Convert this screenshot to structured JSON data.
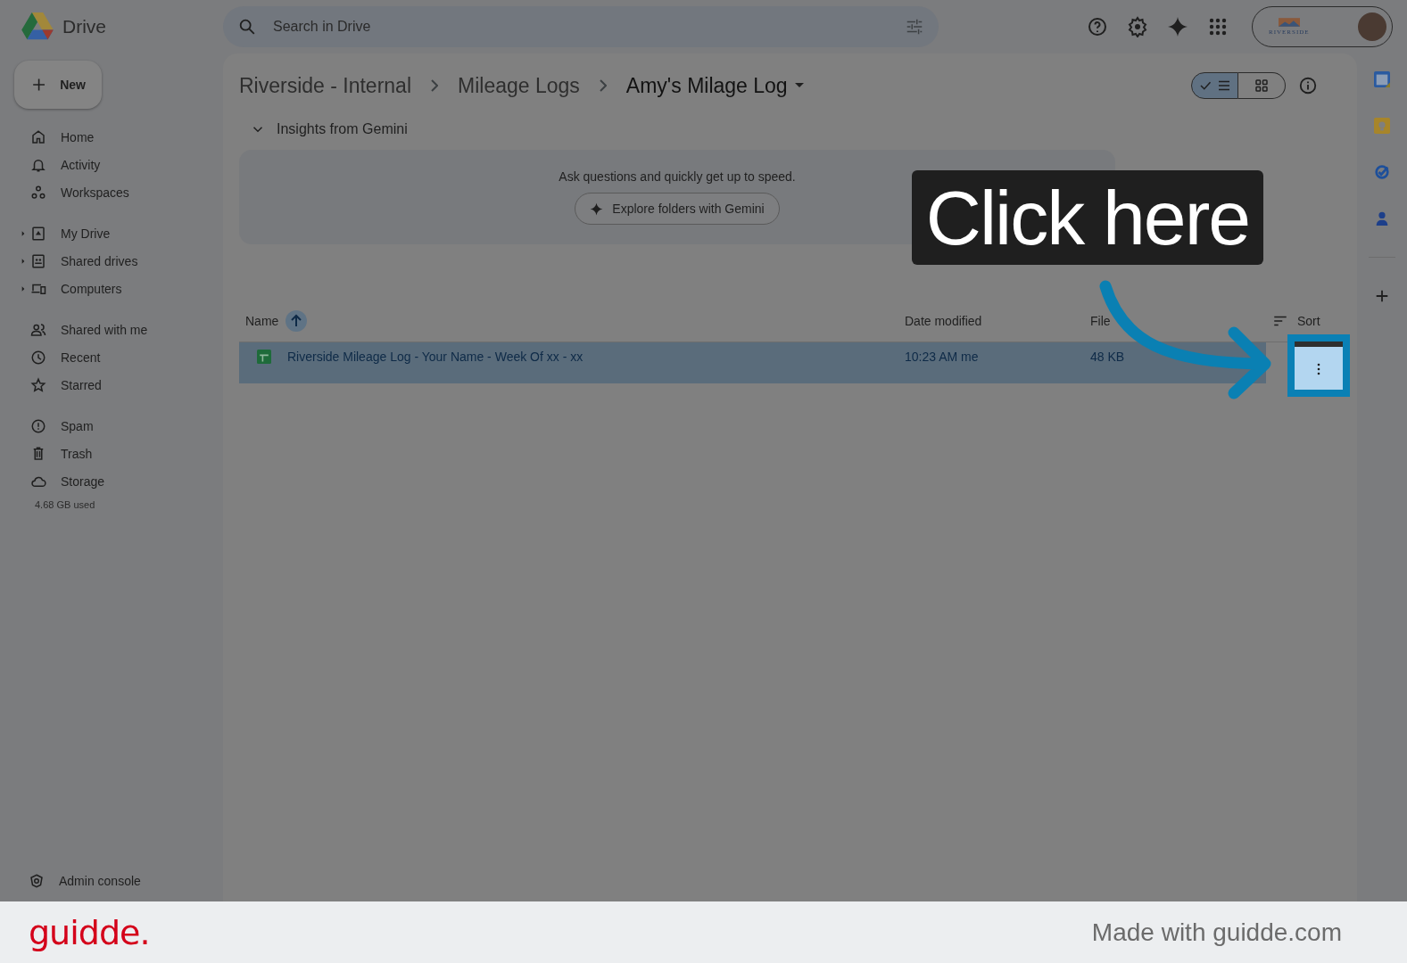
{
  "app": {
    "name": "Drive"
  },
  "search": {
    "placeholder": "Search in Drive"
  },
  "account": {
    "org": "RIVERSIDE"
  },
  "new_button": "New",
  "sidebar": {
    "groups": [
      [
        {
          "kind": "home",
          "label": "Home",
          "expandable": false
        },
        {
          "kind": "activity",
          "label": "Activity",
          "expandable": false
        },
        {
          "kind": "workspaces",
          "label": "Workspaces",
          "expandable": false
        }
      ],
      [
        {
          "kind": "mydrive",
          "label": "My Drive",
          "expandable": true
        },
        {
          "kind": "shareddrives",
          "label": "Shared drives",
          "expandable": true
        },
        {
          "kind": "computers",
          "label": "Computers",
          "expandable": true
        }
      ],
      [
        {
          "kind": "shared",
          "label": "Shared with me",
          "expandable": false
        },
        {
          "kind": "recent",
          "label": "Recent",
          "expandable": false
        },
        {
          "kind": "starred",
          "label": "Starred",
          "expandable": false
        }
      ],
      [
        {
          "kind": "spam",
          "label": "Spam",
          "expandable": false
        },
        {
          "kind": "trash",
          "label": "Trash",
          "expandable": false
        },
        {
          "kind": "storage",
          "label": "Storage",
          "expandable": false
        }
      ]
    ],
    "storage_used": "4.68 GB used",
    "admin": "Admin console"
  },
  "breadcrumbs": [
    {
      "label": "Riverside - Internal",
      "current": false
    },
    {
      "label": "Mileage Logs",
      "current": false
    },
    {
      "label": "Amy's Milage Log",
      "current": true
    }
  ],
  "view_toggle": [
    {
      "kind": "list",
      "selected": true
    },
    {
      "kind": "grid",
      "selected": false
    }
  ],
  "insights": {
    "title": "Insights from Gemini",
    "expanded": true,
    "text": "Ask questions and quickly get up to speed.",
    "button": "Explore folders with Gemini"
  },
  "table": {
    "columns": [
      "Name",
      "Date modified",
      "File"
    ],
    "sort_label": "Sort",
    "rows": [
      {
        "name": "Riverside Mileage Log - Your Name - Week Of xx - xx",
        "modified": "10:23 AM me",
        "size": "48 KB",
        "selected": true
      }
    ]
  },
  "callout": {
    "text": "Click here"
  },
  "footer": {
    "brand": "guidde.",
    "credit": "Made with guidde.com"
  }
}
